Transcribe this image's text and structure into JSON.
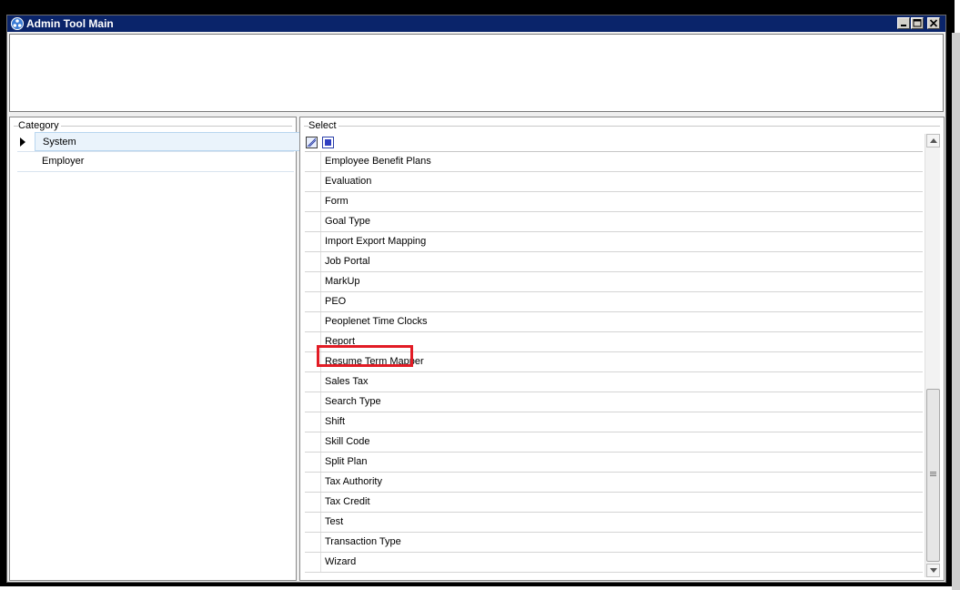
{
  "window": {
    "title": "Admin Tool Main",
    "title_bar_color": "#0a246a",
    "controls": [
      "minimize-icon",
      "maximize-icon",
      "close-icon"
    ]
  },
  "category_panel": {
    "label": "Category",
    "rows": [
      {
        "label": "System",
        "selected": true
      },
      {
        "label": "Employer",
        "selected": false
      }
    ]
  },
  "select_panel": {
    "label": "Select",
    "header_icons": [
      "select-all-icon",
      "checkbox-icon"
    ],
    "rows": [
      "Employee Benefit Plans",
      "Evaluation",
      "Form",
      "Goal Type",
      "Import Export Mapping",
      "Job Portal",
      "MarkUp",
      "PEO",
      "Peoplenet Time Clocks",
      "Report",
      "Resume Term Mapper",
      "Sales Tax",
      "Search Type",
      "Shift",
      "Skill Code",
      "Split Plan",
      "Tax Authority",
      "Tax Credit",
      "Test",
      "Transaction Type",
      "Wizard"
    ],
    "highlighted_row": "Report",
    "highlight_color": "#e21c25"
  }
}
